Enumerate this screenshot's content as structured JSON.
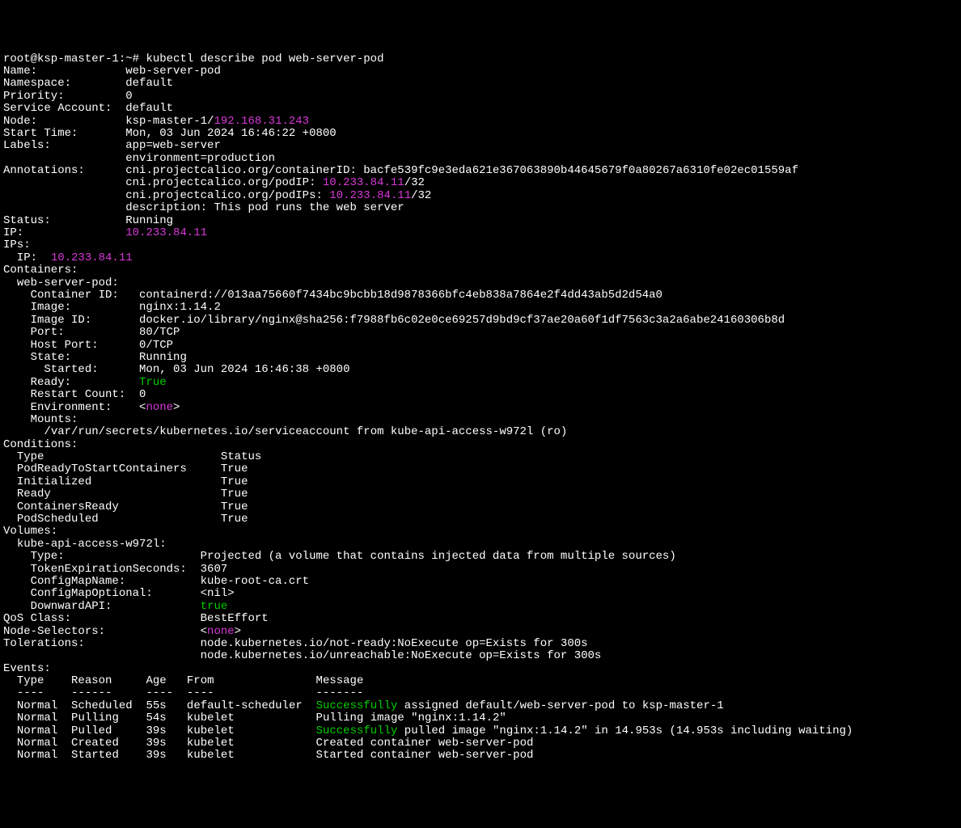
{
  "prompt": {
    "user": "root@ksp-master-1",
    "sep": ":~# ",
    "command": "kubectl describe pod web-server-pod"
  },
  "fields": {
    "Name": "web-server-pod",
    "Namespace": "default",
    "Priority": "0",
    "ServiceAccount": "default",
    "NodeLabel": "Node:",
    "NodeName": "ksp-master-1/",
    "NodeIP": "192.168.31.243",
    "StartTime": "Mon, 03 Jun 2024 16:46:22 +0800",
    "LabelsApp": "app=web-server",
    "LabelsEnv": "environment=production",
    "AnnoContainerID": "cni.projectcalico.org/containerID: bacfe539fc9e3eda621e367063890b44645679f0a80267a6310fe02ec01559af",
    "AnnoPodIPPrefix": "cni.projectcalico.org/podIP: ",
    "AnnoPodIP": "10.233.84.11",
    "AnnoPodIPSuffix": "/32",
    "AnnoPodIPsPrefix": "cni.projectcalico.org/podIPs: ",
    "AnnoPodIPs": "10.233.84.11",
    "AnnoPodIPsSuffix": "/32",
    "AnnoDescription": "description: This pod runs the web server",
    "Status": "Running",
    "IP": "10.233.84.11",
    "IPsIP": "10.233.84.11"
  },
  "container": {
    "Name": "web-server-pod:",
    "ContainerID": "containerd://013aa75660f7434bc9bcbb18d9878366bfc4eb838a7864e2f4dd43ab5d2d54a0",
    "Image": "nginx:1.14.2",
    "ImageID": "docker.io/library/nginx@sha256:f7988fb6c02e0ce69257d9bd9cf37ae20a60f1df7563c3a2a6abe24160306b8d",
    "Port": "80/TCP",
    "HostPort": "0/TCP",
    "State": "Running",
    "Started": "Mon, 03 Jun 2024 16:46:38 +0800",
    "Ready": "True",
    "RestartCount": "0",
    "EnvironmentNone": "none",
    "Mounts": "/var/run/secrets/kubernetes.io/serviceaccount from kube-api-access-w972l (ro)"
  },
  "conditions": {
    "h1": "Type",
    "h2": "Status",
    "r1c1": "PodReadyToStartContainers",
    "r1c2": "True",
    "r2c1": "Initialized",
    "r2c2": "True",
    "r3c1": "Ready",
    "r3c2": "True",
    "r4c1": "ContainersReady",
    "r4c2": "True",
    "r5c1": "PodScheduled",
    "r5c2": "True"
  },
  "volumes": {
    "Name": "kube-api-access-w972l:",
    "Type": "Projected (a volume that contains injected data from multiple sources)",
    "TokenExpirationSeconds": "3607",
    "ConfigMapName": "kube-root-ca.crt",
    "ConfigMapOptional": "<nil>",
    "DownwardAPI": "true"
  },
  "misc": {
    "QoSClass": "BestEffort",
    "NodeSelectorsNone": "none",
    "Tolerations1": "node.kubernetes.io/not-ready:NoExecute op=Exists for 300s",
    "Tolerations2": "node.kubernetes.io/unreachable:NoExecute op=Exists for 300s"
  },
  "events": {
    "h": {
      "Type": "Type",
      "Reason": "Reason",
      "Age": "Age",
      "From": "From",
      "Message": "Message"
    },
    "d": {
      "Type": "----",
      "Reason": "------",
      "Age": "----",
      "From": "----",
      "Message": "-------"
    },
    "r1": {
      "Type": "Normal",
      "Reason": "Scheduled",
      "Age": "55s",
      "From": "default-scheduler",
      "Msg1": "Successfully",
      "Msg2": " assigned default/web-server-pod to ksp-master-1"
    },
    "r2": {
      "Type": "Normal",
      "Reason": "Pulling",
      "Age": "54s",
      "From": "kubelet",
      "Msg": "Pulling image \"nginx:1.14.2\""
    },
    "r3": {
      "Type": "Normal",
      "Reason": "Pulled",
      "Age": "39s",
      "From": "kubelet",
      "Msg1": "Successfully",
      "Msg2": " pulled image \"nginx:1.14.2\" in 14.953s (14.953s including waiting)"
    },
    "r4": {
      "Type": "Normal",
      "Reason": "Created",
      "Age": "39s",
      "From": "kubelet",
      "Msg": "Created container web-server-pod"
    },
    "r5": {
      "Type": "Normal",
      "Reason": "Started",
      "Age": "39s",
      "From": "kubelet",
      "Msg": "Started container web-server-pod"
    }
  }
}
